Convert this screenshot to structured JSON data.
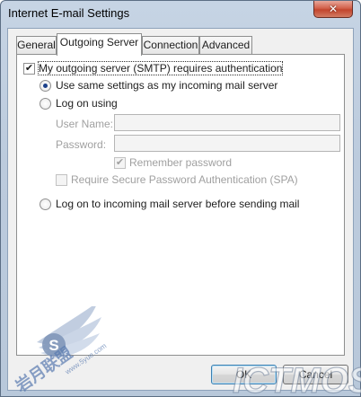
{
  "window": {
    "title": "Internet E-mail Settings",
    "close_glyph": "✕"
  },
  "tabs": [
    {
      "label": "General",
      "active": false
    },
    {
      "label": "Outgoing Server",
      "active": true
    },
    {
      "label": "Connection",
      "active": false
    },
    {
      "label": "Advanced",
      "active": false
    }
  ],
  "outgoing": {
    "requires_auth_label": "My outgoing server (SMTP) requires authentication",
    "requires_auth_checked": true,
    "use_same_label": "Use same settings as my incoming mail server",
    "use_same_selected": true,
    "log_on_using_label": "Log on using",
    "user_name_label": "User Name:",
    "user_name_value": "",
    "password_label": "Password:",
    "password_value": "",
    "remember_password_label": "Remember password",
    "remember_password_checked": true,
    "spa_label": "Require Secure Password Authentication (SPA)",
    "spa_checked": false,
    "log_on_incoming_label": "Log on to incoming mail server before sending mail"
  },
  "buttons": {
    "ok_label": "OK",
    "cancel_label": "Cancel"
  },
  "watermark": {
    "left_text": "岩月联盟",
    "left_url": "www.5yue.com",
    "left_badge": "S",
    "right_text": "ICTMOS"
  },
  "colors": {
    "title_bar": "#bccbdd",
    "close_button": "#c2452d",
    "radio_dot": "#1a3f8a",
    "default_button_border": "#3c7fb1"
  },
  "icons": {
    "check": "✔",
    "close": "x-icon"
  }
}
